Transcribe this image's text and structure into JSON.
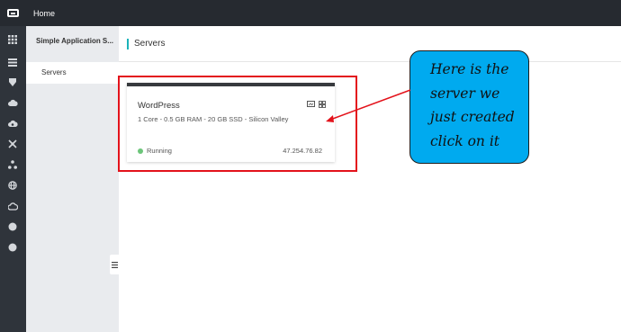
{
  "topbar": {
    "home_label": "Home"
  },
  "iconbar": {
    "icons": [
      "grid-icon",
      "list-icon",
      "shield-icon",
      "cloud-icon",
      "cloud-sync-icon",
      "network-icon",
      "cluster-icon",
      "globe-icon",
      "gear-cloud-icon",
      "circle-icon",
      "circle-icon"
    ]
  },
  "sidenav": {
    "title": "Simple Application S...",
    "items": [
      {
        "label": "Servers"
      }
    ]
  },
  "main": {
    "title": "Servers"
  },
  "server_card": {
    "name": "WordPress",
    "spec": "1 Core - 0.5 GB RAM - 20 GB SSD - Silicon Valley",
    "status": "Running",
    "ip": "47.254.76.82",
    "status_color": "#6cc57a"
  },
  "annotation": {
    "lines": [
      "Here is the",
      "server we",
      "just created",
      "click on it"
    ],
    "box_color": "#00aaef",
    "highlight_color": "#e3121b"
  }
}
